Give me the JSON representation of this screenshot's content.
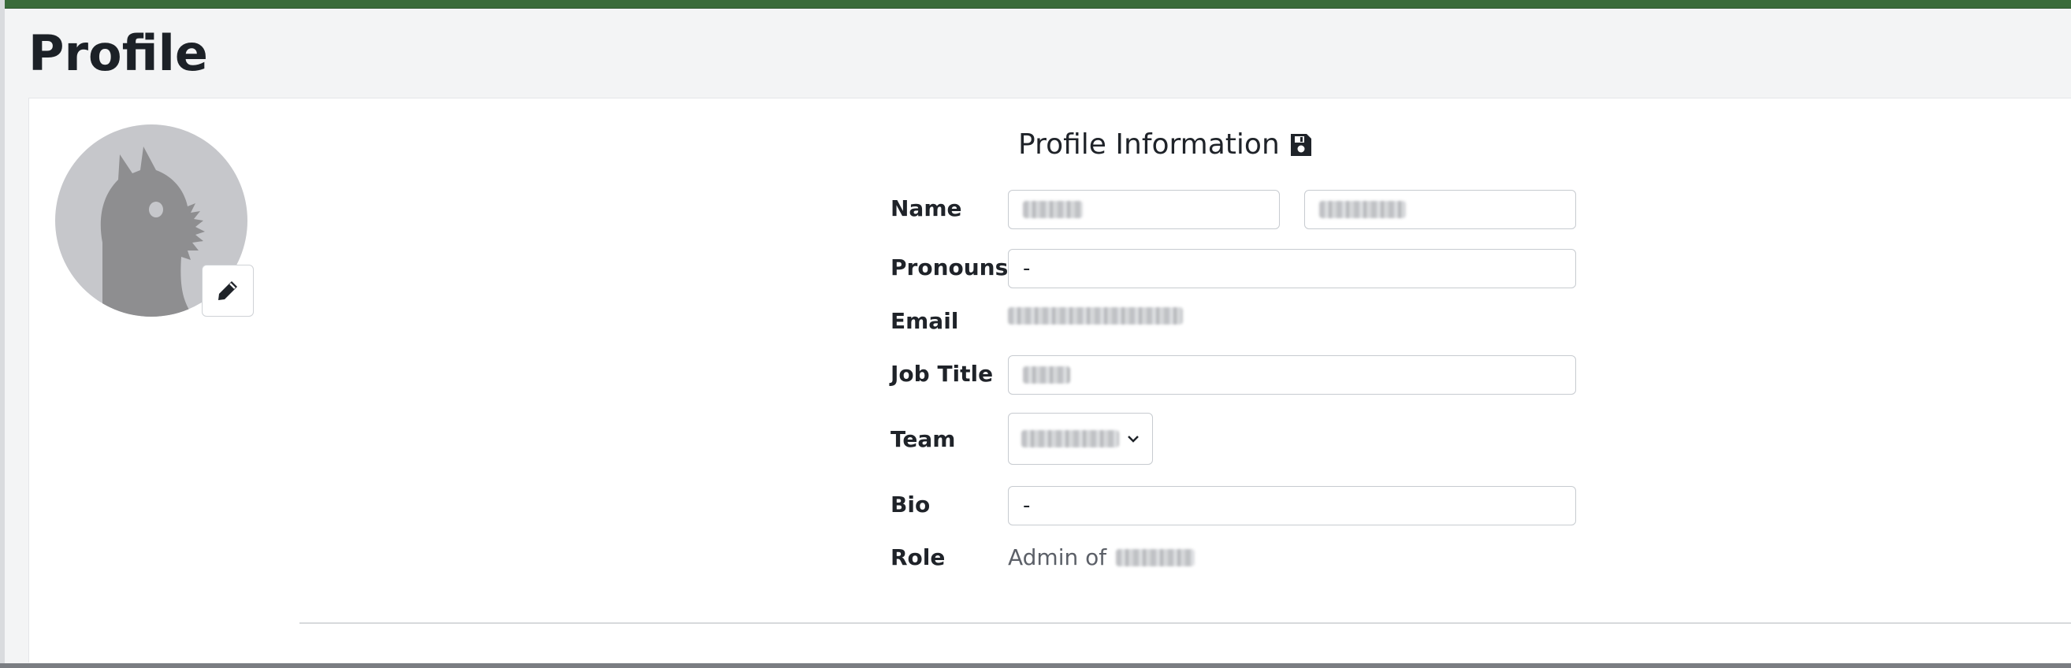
{
  "page": {
    "title": "Profile"
  },
  "profile_section": {
    "title": "Profile Information",
    "save_icon": "save-icon"
  },
  "fields": {
    "name_label": "Name",
    "first_name_value": "",
    "last_name_value": "",
    "pronouns_label": "Pronouns",
    "pronouns_value": "-",
    "email_label": "Email",
    "email_value": "",
    "job_title_label": "Job Title",
    "job_title_value": "",
    "team_label": "Team",
    "team_value": "",
    "bio_label": "Bio",
    "bio_value": "-",
    "role_label": "Role",
    "role_prefix": "Admin of",
    "role_org": ""
  },
  "avatar": {
    "edit_icon": "pencil-icon"
  },
  "colors": {
    "accent": "#3a6b3a",
    "avatar_bg": "#c6c7cb",
    "avatar_figure": "#8e8e90"
  }
}
